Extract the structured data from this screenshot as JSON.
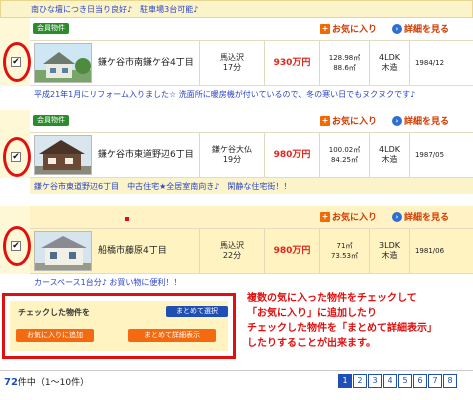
{
  "top_comment": "南ひな壇につき日当り良好♪　駐車場3台可能♪",
  "properties": [
    {
      "badge": "会員物件",
      "fav_label": "お気に入り",
      "detail_label": "詳細を見る",
      "checkbox": "✔",
      "address": "鎌ケ谷市南鎌ケ谷4丁目",
      "station": "馬込沢",
      "walk": "17分",
      "price": "930万円",
      "land_area": "128.98㎡",
      "building_area": "88.6㎡",
      "layout_rooms": "4LDK",
      "layout_structure": "木造",
      "built": "1984/12",
      "comment": "平成21年1月にリフォーム入りました☆ 洗面所に暖房機が付いているので、冬の寒い日でもヌクヌクです♪"
    },
    {
      "badge": "会員物件",
      "fav_label": "お気に入り",
      "detail_label": "詳細を見る",
      "checkbox": "✔",
      "address": "鎌ケ谷市東道野辺6丁目",
      "station": "鎌ケ谷大仏",
      "walk": "19分",
      "price": "980万円",
      "land_area": "100.02㎡",
      "building_area": "84.25㎡",
      "layout_rooms": "4LDK",
      "layout_structure": "木造",
      "built": "1987/05",
      "comment": "鎌ケ谷市東道野辺6丁目　中古住宅★全居室南向き♪　閑静な住宅街！！"
    },
    {
      "badge": "",
      "fav_label": "お気に入り",
      "detail_label": "詳細を見る",
      "checkbox": "✔",
      "address": "船橋市藤原4丁目",
      "station": "馬込沢",
      "walk": "22分",
      "price": "980万円",
      "land_area": "71㎡",
      "building_area": "73.53㎡",
      "layout_rooms": "3LDK",
      "layout_structure": "木造",
      "built": "1981/06",
      "comment": "カースペース1台分♪ お買い物に便利！！"
    }
  ],
  "action_box": {
    "title": "チェックした物件を",
    "select_all": "まとめて選択",
    "add_favorite": "お気に入りに追加",
    "show_detail": "まとめて詳細表示"
  },
  "explanation": [
    "複数の気に入った物件をチェックして",
    "「お気に入り」に追加したり",
    "チェックした物件を「まとめて詳細表示」",
    "したりすることが出来ます。"
  ],
  "pager": {
    "total": "72",
    "suffix": "件中（1〜10件）",
    "pages": [
      "1",
      "2",
      "3",
      "4",
      "5",
      "6",
      "7",
      "8"
    ],
    "active_page": "1"
  },
  "colors": {
    "accent_red": "#e01010",
    "link_blue": "#2a45c8",
    "row_tan": "#fff3c2",
    "badge_green": "#2c8c2c"
  }
}
